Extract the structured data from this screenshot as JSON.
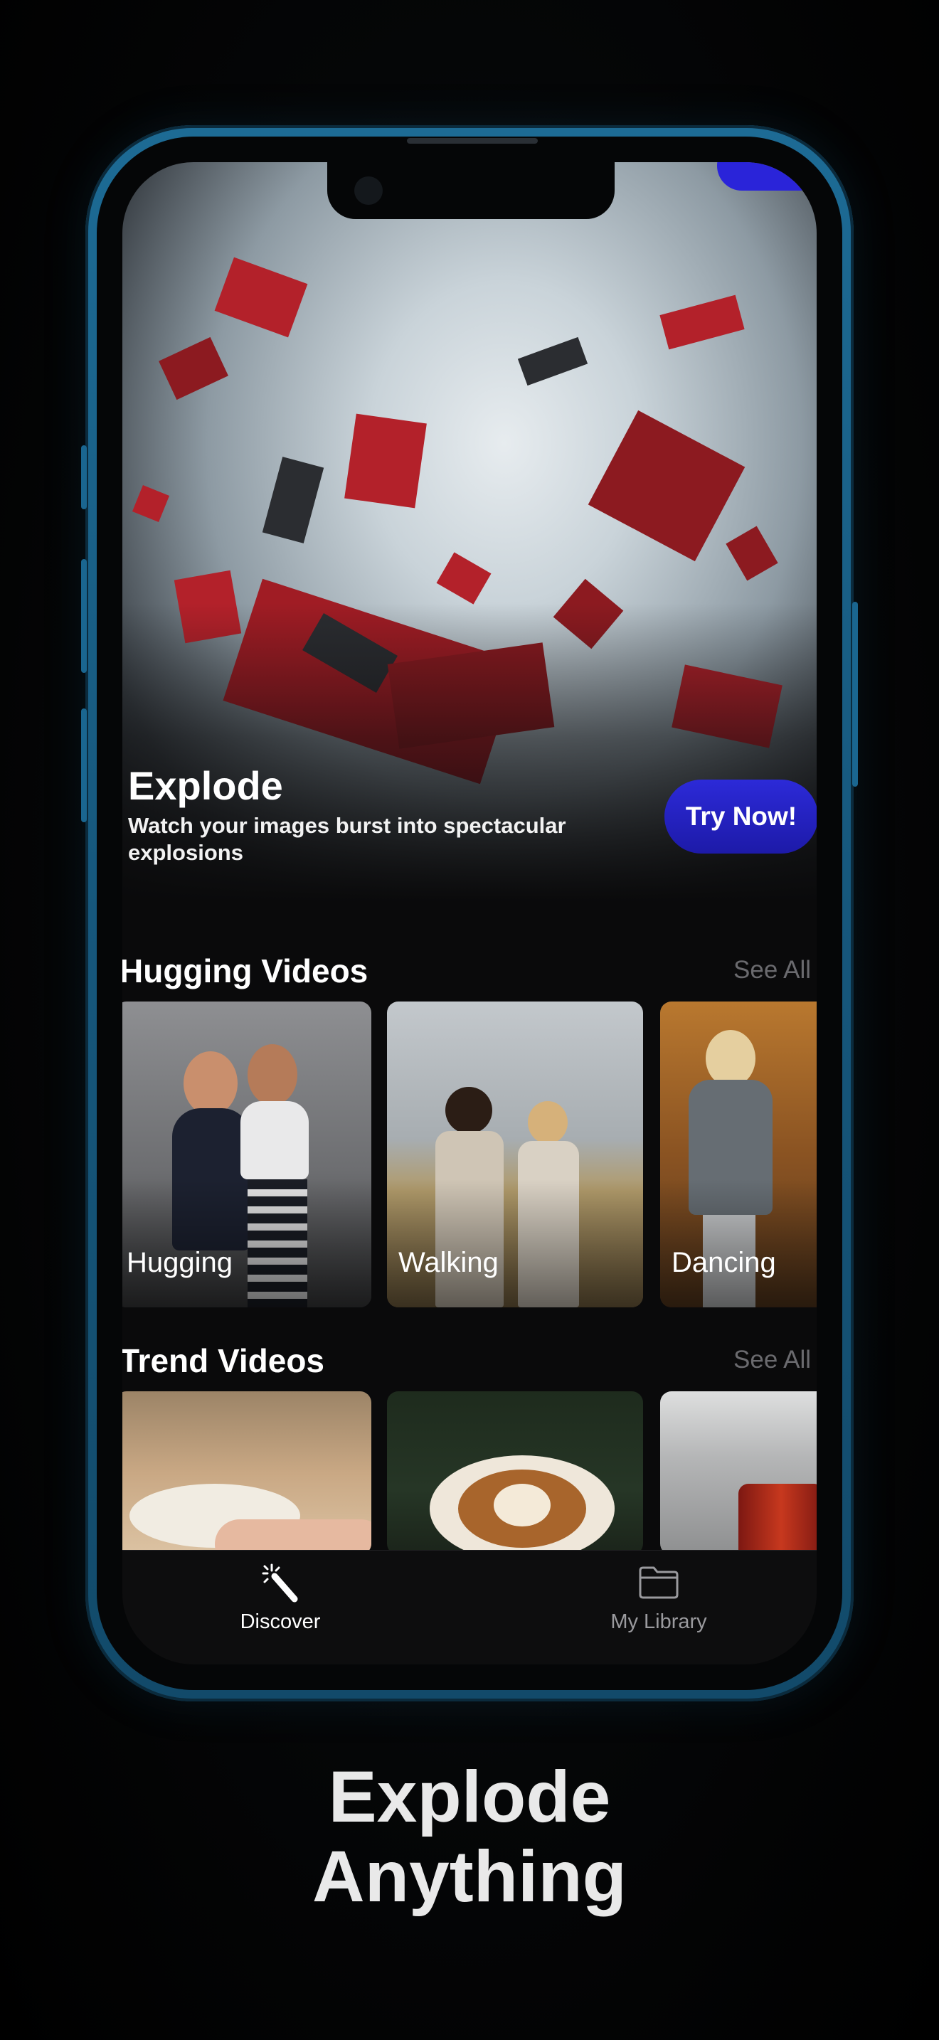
{
  "hero": {
    "title": "Explode",
    "subtitle": "Watch your images burst into spectacular explosions",
    "cta_label": "Try Now!"
  },
  "sections": [
    {
      "title": "Hugging Videos",
      "see_all": "See All",
      "cards": [
        {
          "label": "Hugging"
        },
        {
          "label": "Walking"
        },
        {
          "label": "Dancing"
        }
      ]
    },
    {
      "title": "Trend Videos",
      "see_all": "See All",
      "cards": [
        {
          "label": ""
        },
        {
          "label": ""
        },
        {
          "label": ""
        }
      ]
    }
  ],
  "tabbar": {
    "tabs": [
      {
        "label": "Discover",
        "icon": "magic-wand-icon",
        "active": true
      },
      {
        "label": "My Library",
        "icon": "folder-icon",
        "active": false
      }
    ]
  },
  "caption": {
    "line1": "Explode",
    "line2": "Anything"
  },
  "colors": {
    "accent": "#2a24d9",
    "frame": "#1d6b95",
    "background": "#000000"
  }
}
